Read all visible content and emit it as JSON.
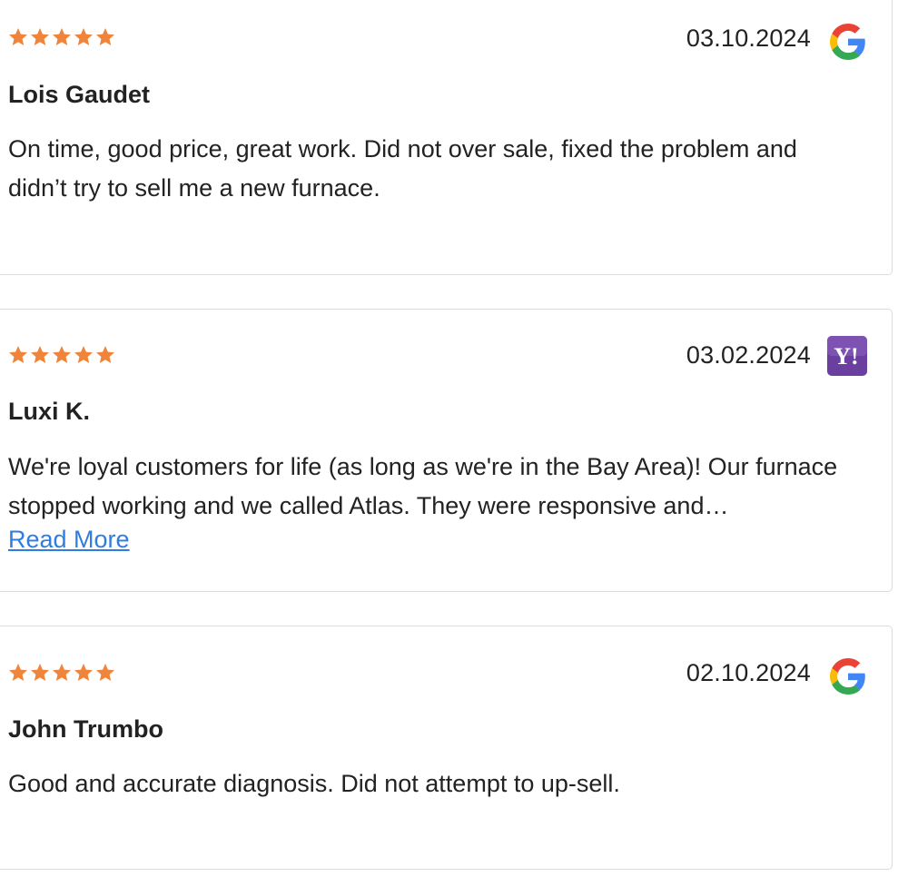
{
  "colors": {
    "star": "#f0843a",
    "link": "#2f7de1",
    "card_border": "#dcdcdc",
    "yahoo_purple": "#6b3fa0"
  },
  "reviews": [
    {
      "rating": 5,
      "date": "03.10.2024",
      "source_icon": "google-icon",
      "author": "Lois Gaudet",
      "text": "On time, good price, great work. Did not over sale, fixed the problem and didn’t try to sell me a new furnace."
    },
    {
      "rating": 5,
      "date": "03.02.2024",
      "source_icon": "yahoo-icon",
      "author": "Luxi K.",
      "text": "We're loyal customers for life (as long as we're in the Bay Area)! Our furnace stopped working and we called Atlas. They were responsive and…",
      "read_more_label": "Read More"
    },
    {
      "rating": 5,
      "date": "02.10.2024",
      "source_icon": "google-icon",
      "author": "John Trumbo",
      "text": "Good and accurate diagnosis. Did not attempt to up-sell."
    }
  ]
}
